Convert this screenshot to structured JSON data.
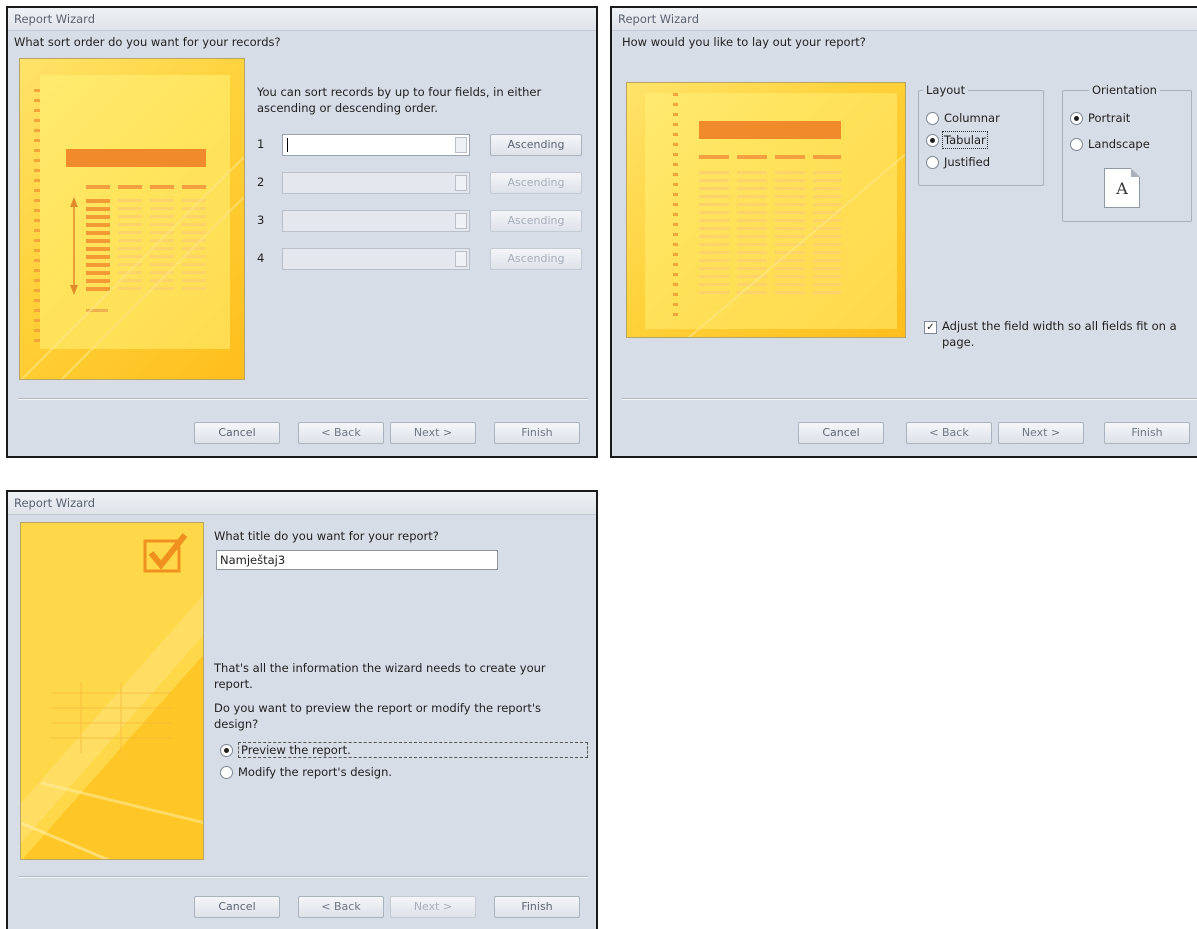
{
  "wizard1": {
    "title": "Report Wizard",
    "question": "What sort order do you want for your records?",
    "instructions": "You can sort records by up to four fields, in either ascending or descending order.",
    "sort_rows": [
      {
        "num": "1",
        "value": "",
        "order": "Ascending",
        "enabled": true
      },
      {
        "num": "2",
        "value": "",
        "order": "Ascending",
        "enabled": false
      },
      {
        "num": "3",
        "value": "",
        "order": "Ascending",
        "enabled": false
      },
      {
        "num": "4",
        "value": "",
        "order": "Ascending",
        "enabled": false
      }
    ],
    "buttons": {
      "cancel": "Cancel",
      "back": "< Back",
      "next": "Next >",
      "finish": "Finish"
    }
  },
  "wizard2": {
    "title": "Report Wizard",
    "question": "How would you like to lay out your report?",
    "layout_label": "Layout",
    "layout_options": [
      "Columnar",
      "Tabular",
      "Justified"
    ],
    "layout_selected": "Tabular",
    "orientation_label": "Orientation",
    "orientation_options": [
      "Portrait",
      "Landscape"
    ],
    "orientation_selected": "Portrait",
    "page_icon_letter": "A",
    "adjust_checkbox_label": "Adjust the field width so all fields fit on a page.",
    "adjust_checked": true,
    "buttons": {
      "cancel": "Cancel",
      "back": "< Back",
      "next": "Next >",
      "finish": "Finish"
    }
  },
  "wizard3": {
    "title": "Report Wizard",
    "question": "What title do you want for your report?",
    "title_value": "Namještaj3",
    "info_text": "That's all the information the wizard needs to create your report.",
    "preview_question": "Do you want to preview the report or modify the report's design?",
    "options": [
      "Preview the report.",
      "Modify the report's design."
    ],
    "selected": "Preview the report.",
    "buttons": {
      "cancel": "Cancel",
      "back": "< Back",
      "next": "Next >",
      "finish": "Finish"
    }
  },
  "colors": {
    "dialog_bg": "#d7dde6",
    "art_yellow": "#ffd23a",
    "art_orange": "#f39a2a"
  }
}
